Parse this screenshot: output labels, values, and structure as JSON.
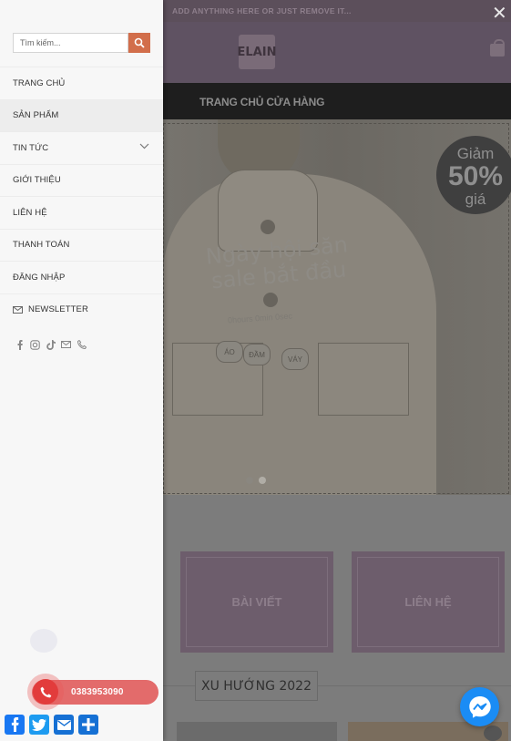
{
  "topbar": {
    "text": "ADD ANYTHING HERE OR JUST REMOVE IT..."
  },
  "header": {
    "logo_text": "ELAIN"
  },
  "nav": {
    "item": "TRANG CHỦ CỬA HÀNG"
  },
  "hero": {
    "badge_top": "Giảm",
    "badge_value": "50%",
    "badge_bottom": "giá",
    "title": "Ngày hội săn sale bắt đầu",
    "countdown": "0hours  0min  0sec",
    "tags": [
      "ÁO",
      "ĐẦM",
      "VÁY"
    ],
    "active_slide": 2
  },
  "boxes": [
    "BÀI VIẾT",
    "LIÊN HỆ"
  ],
  "section_title": "XU HƯỚNG 2022",
  "sidebar": {
    "search_placeholder": "Tìm kiếm...",
    "menu": [
      {
        "label": "TRANG CHỦ"
      },
      {
        "label": "SẢN PHẨM"
      },
      {
        "label": "TIN TỨC",
        "has_children": true
      },
      {
        "label": "GIỚI THIỆU"
      },
      {
        "label": "LIÊN HỆ"
      },
      {
        "label": "THANH TOÁN"
      },
      {
        "label": "ĐĂNG NHẬP"
      },
      {
        "label": "NEWSLETTER",
        "icon": "mail-icon"
      }
    ],
    "social_icons": [
      "facebook-icon",
      "instagram-icon",
      "tiktok-icon",
      "email-icon",
      "phone-icon"
    ]
  },
  "call": {
    "phone": "0383953090"
  },
  "share_icons": [
    "facebook-share-icon",
    "twitter-share-icon",
    "email-share-icon",
    "more-share-icon"
  ],
  "colors": {
    "accent": "#d26e4b",
    "call": "#e36b6b",
    "messenger": "#1a8cf5"
  }
}
